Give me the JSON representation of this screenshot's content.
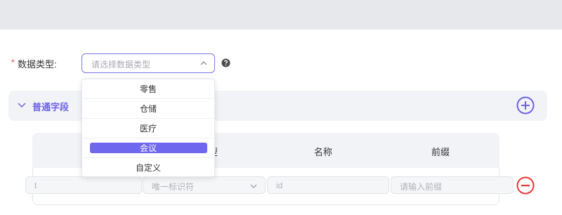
{
  "form": {
    "required_mark": "*",
    "label": "数据类型:",
    "select": {
      "placeholder": "请选择数据类型"
    }
  },
  "dropdown": {
    "options": [
      "零售",
      "仓储",
      "医疗",
      "会议",
      "自定义"
    ],
    "selected": "会议"
  },
  "section": {
    "title": "普通字段"
  },
  "table": {
    "columns": [
      "型",
      "名称",
      "前缀"
    ],
    "row": {
      "first_value": "t",
      "type_value": "唯一标识符",
      "name_value": "id",
      "prefix_placeholder": "请输入前缀"
    }
  },
  "colors": {
    "accent": "#6c63e8",
    "selected_option": "#6f68ee",
    "danger": "#e53935",
    "required": "#e03a3a"
  },
  "icons": {
    "select_chevron": "chevron-down-icon",
    "help": "question-circle-icon",
    "collapse": "chevron-down-icon",
    "add": "plus-circle-icon",
    "remove": "minus-circle-icon"
  }
}
